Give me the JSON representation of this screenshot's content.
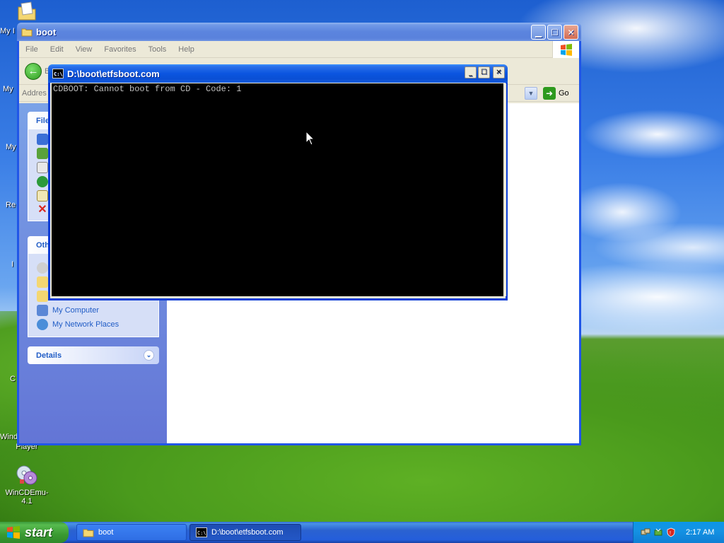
{
  "desktop": {
    "icons": [
      {
        "label": "My I",
        "icon": "my-documents-icon"
      },
      {
        "label": "My",
        "icon": "my-computer-icon"
      },
      {
        "label": "My",
        "icon": "my-network-places-icon"
      },
      {
        "label": "Re",
        "icon": "recycle-bin-icon"
      },
      {
        "label": "I",
        "icon": "internet-explorer-icon"
      },
      {
        "label": "C",
        "icon": "command-prompt-icon"
      },
      {
        "label": "Wind",
        "icon": "windows-media-player-icon"
      },
      {
        "label": "Player",
        "icon": ""
      },
      {
        "label": "WinCDEmu-4.1",
        "icon": "wincdemu-icon"
      }
    ]
  },
  "explorer": {
    "title": "boot",
    "menu": [
      "File",
      "Edit",
      "View",
      "Favorites",
      "Tools",
      "Help"
    ],
    "toolbar": {
      "back_label": "B"
    },
    "address": {
      "label": "Addres",
      "go_label": "Go"
    },
    "taskpane": {
      "file_tasks_header": "File",
      "other_places_header": "Oth",
      "other_places_links": [
        "My Computer",
        "My Network Places"
      ],
      "details_header": "Details"
    }
  },
  "console": {
    "title": "D:\\boot\\etfsboot.com",
    "output": "CDBOOT: Cannot boot from CD - Code: 1"
  },
  "taskbar": {
    "start_label": "start",
    "tasks": [
      {
        "label": "boot",
        "active": false
      },
      {
        "label": "D:\\boot\\etfsboot.com",
        "active": true
      }
    ],
    "clock": "2:17 AM"
  },
  "colors": {
    "xp_blue": "#0a4fd4",
    "start_green": "#3a9a32",
    "taskpane_link": "#215dc6",
    "console_bg": "#000000",
    "console_fg": "#c0c0c0"
  }
}
